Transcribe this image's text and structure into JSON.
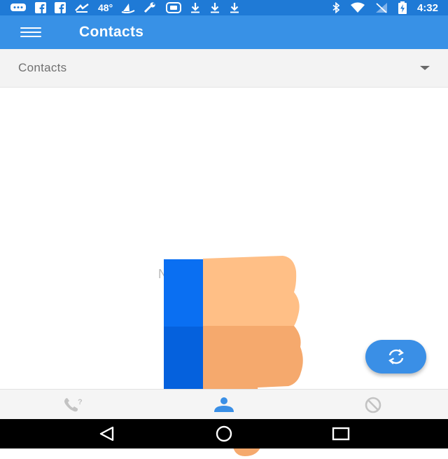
{
  "status_bar": {
    "temperature": "48°",
    "time": "4:32",
    "icons_left": [
      "chat-bubble-icon",
      "facebook-icon",
      "facebook-icon",
      "weather-icon",
      "sail-icon",
      "wrench-icon",
      "sim-card-icon",
      "download-icon",
      "download-icon",
      "download-icon"
    ],
    "icons_right": [
      "bluetooth-icon",
      "wifi-icon",
      "no-signal-icon",
      "battery-charging-icon"
    ]
  },
  "app_bar": {
    "title": "Contacts",
    "menu_icon": "hamburger-menu-icon"
  },
  "filter": {
    "selected": "Contacts",
    "dropdown_icon": "caret-down-icon"
  },
  "main": {
    "empty_text": "N",
    "overlay_icon": "thumbs-down-icon"
  },
  "fab": {
    "icon": "sync-icon"
  },
  "bottom_nav": {
    "items": [
      {
        "icon": "unknown-caller-icon",
        "active": false
      },
      {
        "icon": "contacts-person-icon",
        "active": true
      },
      {
        "icon": "blocked-icon",
        "active": false
      }
    ]
  },
  "system_nav": {
    "buttons": [
      "back-icon",
      "home-icon",
      "recents-icon"
    ]
  },
  "colors": {
    "status_bar": "#1f7ad6",
    "app_bar": "#3891e6",
    "accent": "#3a8fe6",
    "nav_inactive": "#c3c3c3",
    "thumb_light": "#ffbf86",
    "thumb_dark": "#f5a96d",
    "sleeve_light": "#0a6ff2",
    "sleeve_dark": "#0561dd"
  }
}
